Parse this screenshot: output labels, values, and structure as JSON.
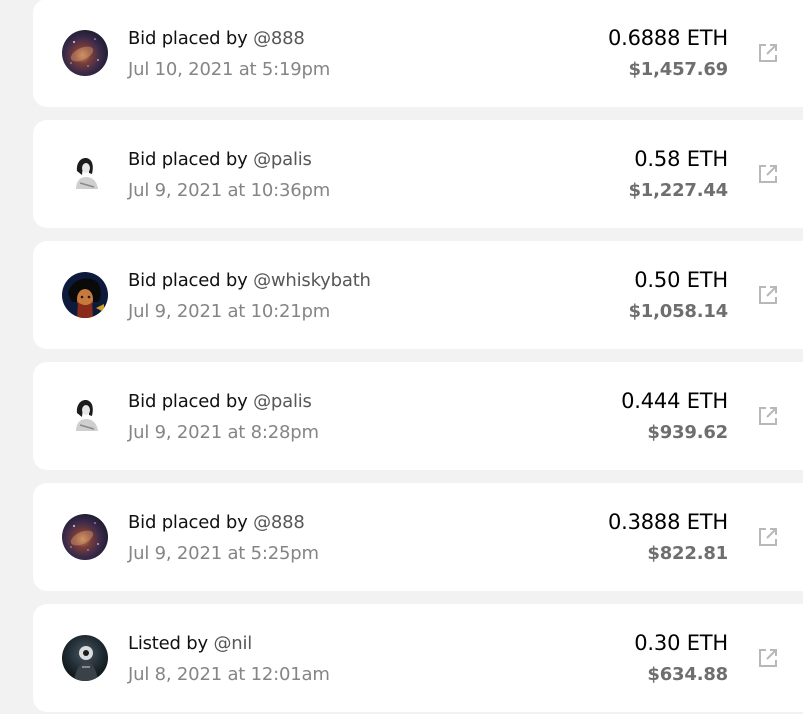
{
  "activity": [
    {
      "label": "Bid placed by",
      "user": "@888",
      "date": "Jul 10, 2021 at 5:19pm",
      "amount": "0.6888 ETH",
      "usd": "$1,457.69",
      "avatar": "galaxy-avatar"
    },
    {
      "label": "Bid placed by",
      "user": "@palis",
      "date": "Jul 9, 2021 at 10:36pm",
      "amount": "0.58 ETH",
      "usd": "$1,227.44",
      "avatar": "sketch-woman-avatar"
    },
    {
      "label": "Bid placed by",
      "user": "@whiskybath",
      "date": "Jul 9, 2021 at 10:21pm",
      "amount": "0.50 ETH",
      "usd": "$1,058.14",
      "avatar": "painted-portrait-avatar"
    },
    {
      "label": "Bid placed by",
      "user": "@palis",
      "date": "Jul 9, 2021 at 8:28pm",
      "amount": "0.444 ETH",
      "usd": "$939.62",
      "avatar": "sketch-woman-avatar"
    },
    {
      "label": "Bid placed by",
      "user": "@888",
      "date": "Jul 9, 2021 at 5:25pm",
      "amount": "0.3888 ETH",
      "usd": "$822.81",
      "avatar": "galaxy-avatar"
    },
    {
      "label": "Listed by",
      "user": "@nil",
      "date": "Jul 8, 2021 at 12:01am",
      "amount": "0.30 ETH",
      "usd": "$634.88",
      "avatar": "dark-figure-avatar"
    }
  ],
  "icons": {
    "external_link": "external-link-icon"
  },
  "colors": {
    "page_background": "#f2f2f2",
    "card_background": "#ffffff",
    "primary_text": "#111111",
    "username_text": "#575757",
    "muted_text": "#858585",
    "usd_text": "#6e6e6e",
    "icon_color": "#b8b8b8"
  }
}
